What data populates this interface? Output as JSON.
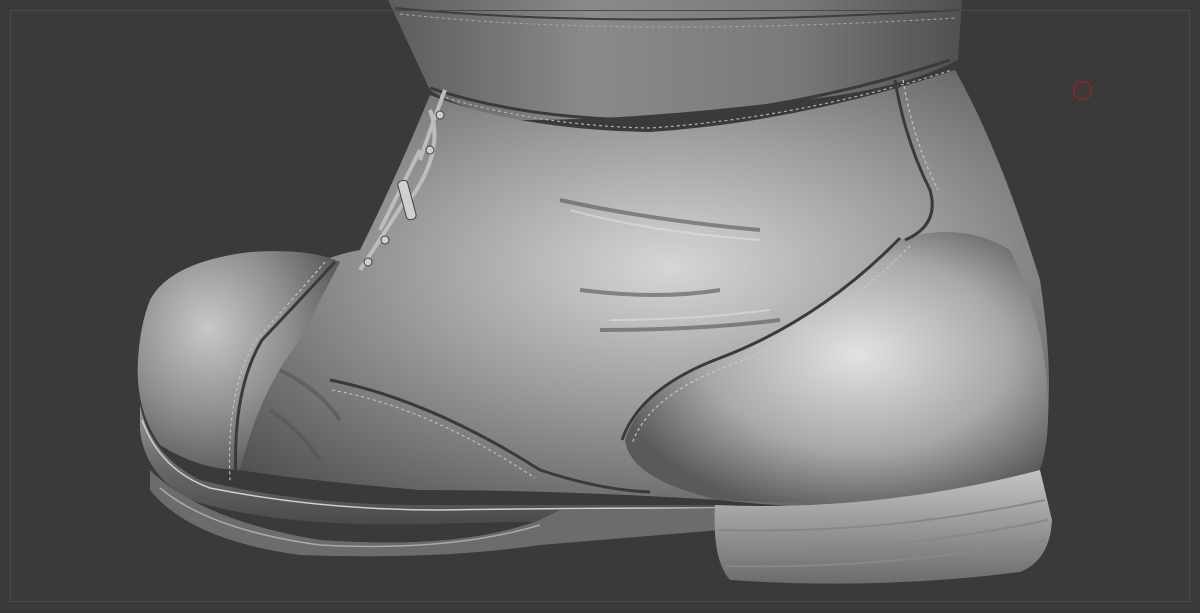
{
  "viewport": {
    "background_color": "#3a3a3a",
    "frame_color": "#4a4a4a"
  },
  "model": {
    "subject": "leather-boot-sculpt",
    "material": "matcap-grey",
    "parts": [
      "toe-cap",
      "vamp",
      "quarter",
      "heel-counter",
      "shaft-cuff",
      "laces",
      "eyelets",
      "sole",
      "heel-stack"
    ]
  },
  "cursor": {
    "icon": "brush-circle-icon",
    "color": "#b02020"
  }
}
